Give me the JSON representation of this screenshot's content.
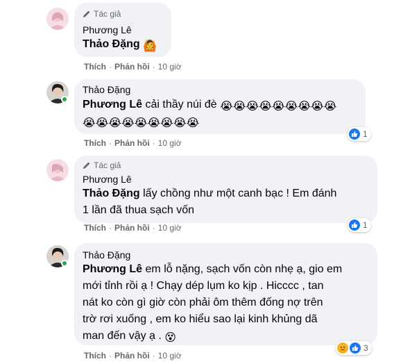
{
  "comments": [
    {
      "author_tag": "Tác giả",
      "author": "Phương Lê",
      "mention": "Thảo Đặng",
      "text": "",
      "emoji_tail": "🙆",
      "actions": {
        "like": "Thích",
        "reply": "Phản hồi",
        "time": "10 giờ"
      }
    },
    {
      "author": "Thảo Đặng",
      "mention": "Phương Lê",
      "text": " cải thầy núi đè ",
      "crying_emoji": "😭",
      "crying_line1_count": 9,
      "crying_line2_count": 9,
      "reaction_count": "1",
      "actions": {
        "like": "Thích",
        "reply": "Phản hồi",
        "time": "10 giờ"
      }
    },
    {
      "author_tag": "Tác giả",
      "author": "Phương Lê",
      "mention": "Thảo Đặng",
      "text_line1": " lấy chồng như một canh bạc ! Em đánh",
      "text_line2": "1 lần đã thua sạch vốn",
      "reaction_count": "1",
      "actions": {
        "like": "Thích",
        "reply": "Phản hồi",
        "time": "10 giờ"
      }
    },
    {
      "author": "Thảo Đặng",
      "mention": "Phương Lê",
      "text_line1": " em lỗ nặng, sạch vốn còn nhẹ ạ, gio em",
      "text_line2": "mới tỉnh rồi ạ ! Chạy dép lụm ko kịp . Hicccc , tan",
      "text_line3": "nát ko còn gì giờ còn phải ôm thêm đống nợ trên",
      "text_line4": "trờ rơi xuống , em ko hiểu sao lại kinh khủng dã",
      "text_line5": "man đến vậy ạ .",
      "emoji_tail": "😵",
      "reaction_count": "3",
      "actions": {
        "like": "Thích",
        "reply": "Phản hồi",
        "time": "10 giờ"
      }
    }
  ],
  "colors": {
    "bubble": "#f0f2f5",
    "like_blue": "#1877f2",
    "meta_gray": "#65676b",
    "online_green": "#31a24c"
  }
}
